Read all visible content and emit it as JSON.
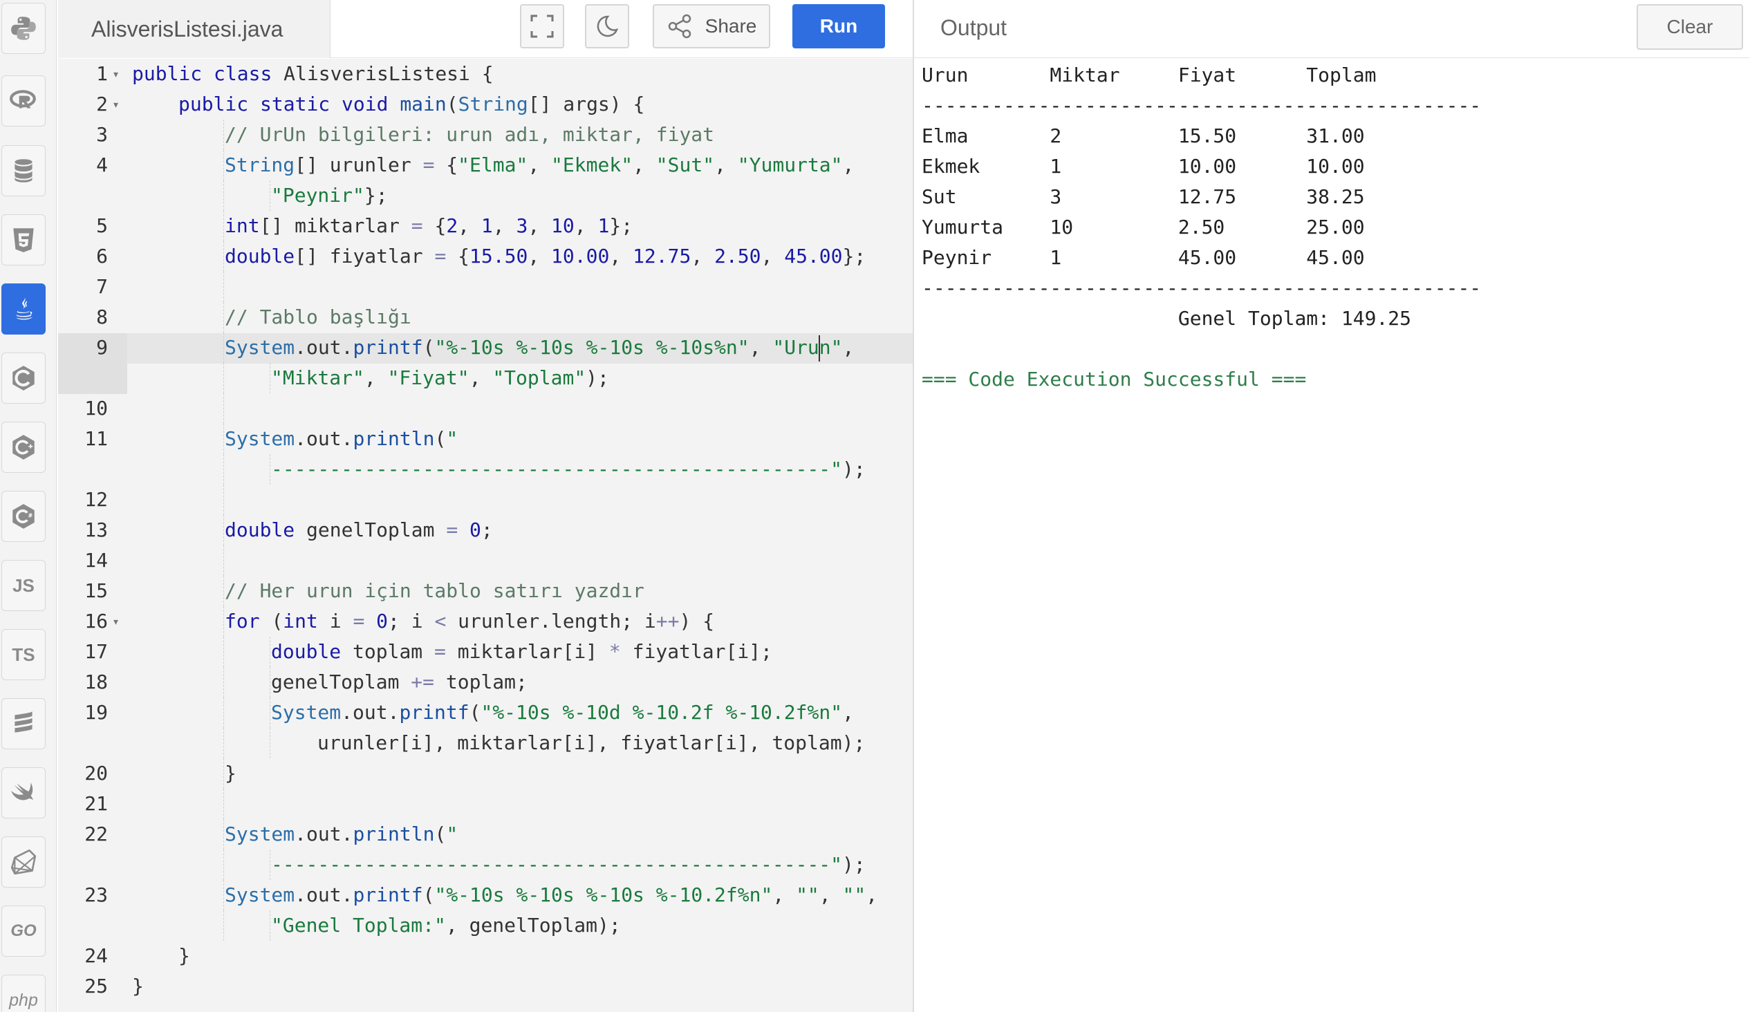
{
  "editor": {
    "filename": "AlisverisListesi.java",
    "share_label": "Share",
    "run_label": "Run",
    "lines": [
      {
        "num": "1",
        "fold": true,
        "indent": 0,
        "tokens": [
          [
            "kw",
            "public "
          ],
          [
            "kw",
            "class "
          ],
          [
            "",
            "AlisverisListesi {"
          ]
        ]
      },
      {
        "num": "2",
        "fold": true,
        "indent": 1,
        "tokens": [
          [
            "kw",
            "public "
          ],
          [
            "kw",
            "static "
          ],
          [
            "kw",
            "void "
          ],
          [
            "fn",
            "main"
          ],
          [
            "",
            "("
          ],
          [
            "cls",
            "String"
          ],
          [
            "",
            "[] args) {"
          ]
        ]
      },
      {
        "num": "3",
        "indent": 2,
        "tokens": [
          [
            "com",
            "// UrUn bilgileri: urun adı, miktar, fiyat"
          ]
        ]
      },
      {
        "num": "4",
        "indent": 2,
        "tokens": [
          [
            "cls",
            "String"
          ],
          [
            "",
            "[] urunler "
          ],
          [
            "op",
            "="
          ],
          [
            "",
            " {"
          ],
          [
            "str",
            "\"Elma\""
          ],
          [
            "",
            ", "
          ],
          [
            "str",
            "\"Ekmek\""
          ],
          [
            "",
            ", "
          ],
          [
            "str",
            "\"Sut\""
          ],
          [
            "",
            ", "
          ],
          [
            "str",
            "\"Yumurta\""
          ],
          [
            "",
            ","
          ]
        ]
      },
      {
        "num": "",
        "indent": 3,
        "tokens": [
          [
            "str",
            "\"Peynir\""
          ],
          [
            "",
            "};"
          ]
        ]
      },
      {
        "num": "5",
        "indent": 2,
        "tokens": [
          [
            "kw",
            "int"
          ],
          [
            "",
            "[] miktarlar "
          ],
          [
            "op",
            "="
          ],
          [
            "",
            " {"
          ],
          [
            "num",
            "2"
          ],
          [
            "",
            ", "
          ],
          [
            "num",
            "1"
          ],
          [
            "",
            ", "
          ],
          [
            "num",
            "3"
          ],
          [
            "",
            ", "
          ],
          [
            "num",
            "10"
          ],
          [
            "",
            ", "
          ],
          [
            "num",
            "1"
          ],
          [
            "",
            "};"
          ]
        ]
      },
      {
        "num": "6",
        "indent": 2,
        "tokens": [
          [
            "kw",
            "double"
          ],
          [
            "",
            "[] fiyatlar "
          ],
          [
            "op",
            "="
          ],
          [
            "",
            " {"
          ],
          [
            "num",
            "15.50"
          ],
          [
            "",
            ", "
          ],
          [
            "num",
            "10.00"
          ],
          [
            "",
            ", "
          ],
          [
            "num",
            "12.75"
          ],
          [
            "",
            ", "
          ],
          [
            "num",
            "2.50"
          ],
          [
            "",
            ", "
          ],
          [
            "num",
            "45.00"
          ],
          [
            "",
            "};"
          ]
        ]
      },
      {
        "num": "7",
        "indent": 2,
        "tokens": []
      },
      {
        "num": "8",
        "indent": 2,
        "tokens": [
          [
            "com",
            "// Tablo başlığı"
          ]
        ]
      },
      {
        "num": "9",
        "indent": 2,
        "tokens": [
          [
            "cls",
            "System"
          ],
          [
            "",
            ".out."
          ],
          [
            "fn",
            "printf"
          ],
          [
            "",
            "("
          ],
          [
            "str",
            "\"%-10s %-10s %-10s %-10s%n\""
          ],
          [
            "",
            ", "
          ],
          [
            "str",
            "\"Urun\""
          ],
          [
            "",
            ","
          ]
        ]
      },
      {
        "num": "",
        "indent": 3,
        "tokens": [
          [
            "str",
            "\"Miktar\""
          ],
          [
            "",
            ", "
          ],
          [
            "str",
            "\"Fiyat\""
          ],
          [
            "",
            ", "
          ],
          [
            "str",
            "\"Toplam\""
          ],
          [
            "",
            ");"
          ]
        ]
      },
      {
        "num": "10",
        "indent": 2,
        "tokens": []
      },
      {
        "num": "11",
        "indent": 2,
        "tokens": [
          [
            "cls",
            "System"
          ],
          [
            "",
            ".out."
          ],
          [
            "fn",
            "println"
          ],
          [
            "",
            "("
          ],
          [
            "str",
            "\""
          ]
        ]
      },
      {
        "num": "",
        "indent": 3,
        "tokens": [
          [
            "str",
            "------------------------------------------------\""
          ],
          [
            "",
            ");"
          ]
        ]
      },
      {
        "num": "12",
        "indent": 2,
        "tokens": []
      },
      {
        "num": "13",
        "indent": 2,
        "tokens": [
          [
            "kw",
            "double "
          ],
          [
            "",
            "genelToplam "
          ],
          [
            "op",
            "="
          ],
          [
            "",
            " "
          ],
          [
            "num",
            "0"
          ],
          [
            "",
            ";"
          ]
        ]
      },
      {
        "num": "14",
        "indent": 2,
        "tokens": []
      },
      {
        "num": "15",
        "indent": 2,
        "tokens": [
          [
            "com",
            "// Her urun için tablo satırı yazdır"
          ]
        ]
      },
      {
        "num": "16",
        "fold": true,
        "indent": 2,
        "tokens": [
          [
            "kw",
            "for "
          ],
          [
            "",
            "("
          ],
          [
            "kw",
            "int "
          ],
          [
            "",
            "i "
          ],
          [
            "op",
            "="
          ],
          [
            "",
            " "
          ],
          [
            "num",
            "0"
          ],
          [
            "",
            "; i "
          ],
          [
            "op",
            "<"
          ],
          [
            "",
            " urunler.length; i"
          ],
          [
            "op",
            "++"
          ],
          [
            "",
            ") {"
          ]
        ]
      },
      {
        "num": "17",
        "indent": 3,
        "tokens": [
          [
            "kw",
            "double "
          ],
          [
            "",
            "toplam "
          ],
          [
            "op",
            "="
          ],
          [
            "",
            " miktarlar[i] "
          ],
          [
            "op",
            "*"
          ],
          [
            "",
            " fiyatlar[i];"
          ]
        ]
      },
      {
        "num": "18",
        "indent": 3,
        "tokens": [
          [
            "",
            "genelToplam "
          ],
          [
            "op",
            "+="
          ],
          [
            "",
            " toplam;"
          ]
        ]
      },
      {
        "num": "19",
        "indent": 3,
        "tokens": [
          [
            "cls",
            "System"
          ],
          [
            "",
            ".out."
          ],
          [
            "fn",
            "printf"
          ],
          [
            "",
            "("
          ],
          [
            "str",
            "\"%-10s %-10d %-10.2f %-10.2f%n\""
          ],
          [
            "",
            ","
          ]
        ]
      },
      {
        "num": "",
        "indent": 4,
        "tokens": [
          [
            "",
            "urunler[i], miktarlar[i], fiyatlar[i], toplam);"
          ]
        ]
      },
      {
        "num": "20",
        "indent": 2,
        "tokens": [
          [
            "",
            "}"
          ]
        ]
      },
      {
        "num": "21",
        "indent": 2,
        "tokens": []
      },
      {
        "num": "22",
        "indent": 2,
        "tokens": [
          [
            "cls",
            "System"
          ],
          [
            "",
            ".out."
          ],
          [
            "fn",
            "println"
          ],
          [
            "",
            "("
          ],
          [
            "str",
            "\""
          ]
        ]
      },
      {
        "num": "",
        "indent": 3,
        "tokens": [
          [
            "str",
            "------------------------------------------------\""
          ],
          [
            "",
            ");"
          ]
        ]
      },
      {
        "num": "23",
        "indent": 2,
        "tokens": [
          [
            "cls",
            "System"
          ],
          [
            "",
            ".out."
          ],
          [
            "fn",
            "printf"
          ],
          [
            "",
            "("
          ],
          [
            "str",
            "\"%-10s %-10s %-10s %-10.2f%n\""
          ],
          [
            "",
            ", "
          ],
          [
            "str",
            "\"\""
          ],
          [
            "",
            ", "
          ],
          [
            "str",
            "\"\""
          ],
          [
            "",
            ","
          ]
        ]
      },
      {
        "num": "",
        "indent": 3,
        "tokens": [
          [
            "str",
            "\"Genel Toplam:\""
          ],
          [
            "",
            ", genelToplam);"
          ]
        ]
      },
      {
        "num": "24",
        "indent": 1,
        "tokens": [
          [
            "",
            "}"
          ]
        ]
      },
      {
        "num": "25",
        "indent": 0,
        "tokens": [
          [
            "",
            "}"
          ]
        ]
      }
    ]
  },
  "output": {
    "title": "Output",
    "clear_label": "Clear",
    "lines": [
      "Urun       Miktar     Fiyat      Toplam",
      "------------------------------------------------",
      "Elma       2          15.50      31.00",
      "Ekmek      1          10.00      10.00",
      "Sut        3          12.75      38.25",
      "Yumurta    10         2.50       25.00",
      "Peynir     1          45.00      45.00",
      "------------------------------------------------",
      "                      Genel Toplam: 149.25",
      "",
      "=== Code Execution Successful ==="
    ]
  },
  "sidebar": {
    "active_index": 4,
    "languages": [
      {
        "name": "python",
        "icon": "python-icon"
      },
      {
        "name": "r",
        "icon": "r-icon"
      },
      {
        "name": "sql",
        "icon": "database-icon"
      },
      {
        "name": "html",
        "icon": "html5-icon"
      },
      {
        "name": "java",
        "icon": "java-icon"
      },
      {
        "name": "c",
        "icon": "c-icon"
      },
      {
        "name": "cpp",
        "icon": "cpp-icon"
      },
      {
        "name": "csharp",
        "icon": "csharp-icon"
      },
      {
        "name": "javascript",
        "icon": "js-icon",
        "text": "JS"
      },
      {
        "name": "typescript",
        "icon": "ts-icon",
        "text": "TS"
      },
      {
        "name": "scala",
        "icon": "scala-icon"
      },
      {
        "name": "swift",
        "icon": "swift-icon"
      },
      {
        "name": "ruby",
        "icon": "ruby-icon"
      },
      {
        "name": "go",
        "icon": "go-icon",
        "text": "GO"
      },
      {
        "name": "php",
        "icon": "php-icon",
        "text": "php"
      }
    ]
  },
  "colors": {
    "accent": "#2f6ee0",
    "keyword": "#1a1aa6",
    "string": "#1a7a3d",
    "comment": "#5c7a66",
    "success": "#2e7d4a"
  }
}
